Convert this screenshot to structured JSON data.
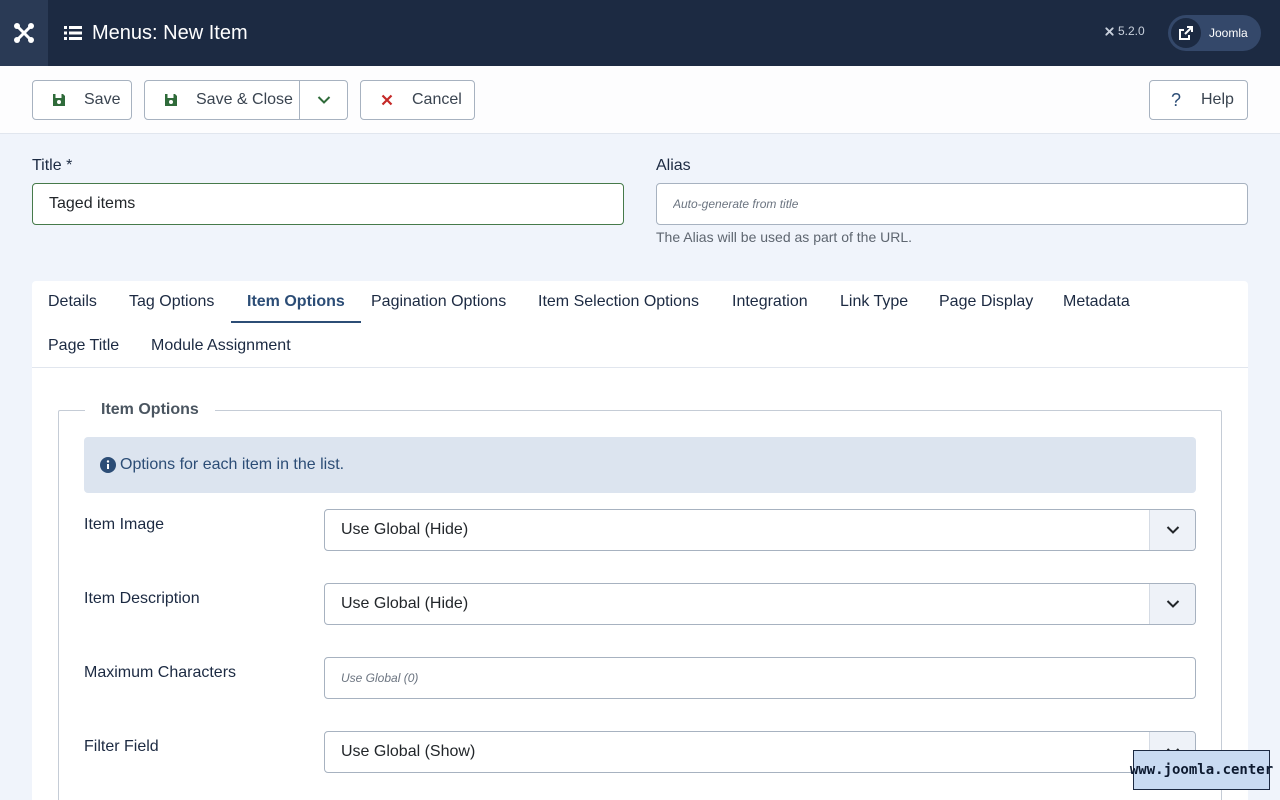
{
  "header": {
    "title": "Menus: New Item",
    "version": "5.2.0",
    "site_link_label": "Joomla"
  },
  "toolbar": {
    "save_label": "Save",
    "save_close_label": "Save & Close",
    "cancel_label": "Cancel",
    "help_label": "Help"
  },
  "form": {
    "title_label": "Title *",
    "title_value": "Taged items",
    "alias_label": "Alias",
    "alias_placeholder": "Auto-generate from title",
    "alias_hint": "The Alias will be used as part of the URL."
  },
  "tabs": [
    {
      "label": "Details"
    },
    {
      "label": "Tag Options"
    },
    {
      "label": "Item Options"
    },
    {
      "label": "Pagination Options"
    },
    {
      "label": "Item Selection Options"
    },
    {
      "label": "Integration"
    },
    {
      "label": "Link Type"
    },
    {
      "label": "Page Display"
    },
    {
      "label": "Metadata"
    },
    {
      "label": "Page Title"
    },
    {
      "label": "Module Assignment"
    }
  ],
  "active_tab": "Item Options",
  "item_options": {
    "legend": "Item Options",
    "info": "Options for each item in the list.",
    "item_image": {
      "label": "Item Image",
      "value": "Use Global (Hide)"
    },
    "item_description": {
      "label": "Item Description",
      "value": "Use Global (Hide)"
    },
    "max_chars": {
      "label": "Maximum Characters",
      "placeholder": "Use Global (0)"
    },
    "filter_field": {
      "label": "Filter Field",
      "value": "Use Global (Show)"
    }
  },
  "watermark": "www.joomla.center",
  "colors": {
    "header_bg": "#1c2a42",
    "accent": "#2c4d76",
    "save_icon": "#2f6b3a",
    "cancel_icon": "#c52827"
  }
}
